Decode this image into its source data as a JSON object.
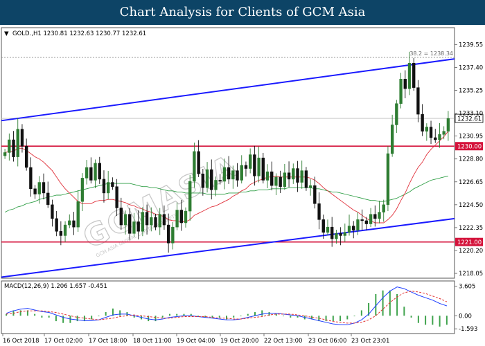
{
  "banner": {
    "title": "Chart Analysis for Clients of GCM Asia",
    "bg_color": "#0d4466"
  },
  "chart_data": [
    {
      "type": "candlestick",
      "symbol": "GOLD.,H1",
      "ohlc_text": "1230.81 1232.63 1230.77 1232.61",
      "header_text": "GOLD.,H1  1230.81 1232.63 1230.77 1232.61",
      "ylim": [
        1217.6,
        1241.0
      ],
      "y_ticks": [
        1239.55,
        1237.4,
        1235.25,
        1233.1,
        1230.95,
        1228.8,
        1226.65,
        1224.5,
        1222.35,
        1220.2,
        1218.05
      ],
      "x_ticks": [
        "16 Oct 2018",
        "17 Oct 02:00",
        "17 Oct 18:00",
        "18 Oct 11:00",
        "19 Oct 04:00",
        "19 Oct 20:00",
        "22 Oct 13:00",
        "23 Oct 06:00",
        "23 Oct 23:01"
      ],
      "current_price": "1232.61",
      "fib_label": "38.2 = 1238.34",
      "fib_level": 1238.34,
      "support_levels": [
        1230.0,
        1221.0
      ],
      "support_labels": [
        "1230.00",
        "1221.00"
      ],
      "trend_channel": {
        "upper": [
          1232.4,
          1238.2
        ],
        "lower": [
          1217.7,
          1223.2
        ]
      },
      "watermark": "GCMASIA",
      "watermark_sub": "GCM ASIA GLOBAL CAPITAL MARKETS",
      "closes": [
        1229.4,
        1230.6,
        1229.0,
        1231.6,
        1230.0,
        1228.0,
        1226.0,
        1225.5,
        1226.6,
        1225.6,
        1224.5,
        1223.2,
        1222.0,
        1221.6,
        1222.6,
        1223.0,
        1222.4,
        1224.8,
        1227.0,
        1228.0,
        1226.8,
        1228.4,
        1226.9,
        1225.6,
        1226.6,
        1226.2,
        1224.2,
        1222.6,
        1223.6,
        1221.8,
        1222.9,
        1222.0,
        1223.8,
        1222.6,
        1223.3,
        1222.4,
        1223.6,
        1222.6,
        1220.9,
        1222.4,
        1224.0,
        1222.8,
        1223.9,
        1226.7,
        1229.5,
        1227.4,
        1226.1,
        1227.8,
        1225.9,
        1226.8,
        1226.7,
        1228.0,
        1226.9,
        1227.7,
        1226.8,
        1228.2,
        1227.9,
        1229.2,
        1227.2,
        1228.9,
        1226.8,
        1227.6,
        1226.3,
        1227.1,
        1226.2,
        1227.5,
        1226.9,
        1227.9,
        1226.6,
        1227.7,
        1226.1,
        1226.3,
        1224.6,
        1223.1,
        1221.9,
        1222.4,
        1221.3,
        1221.8,
        1221.6,
        1221.9,
        1222.5,
        1222.1,
        1223.1,
        1223.0,
        1222.7,
        1223.6,
        1223.2,
        1223.8,
        1224.5,
        1229.3,
        1232.0,
        1234.0,
        1236.3,
        1235.4,
        1237.8,
        1235.5,
        1233.0,
        1231.4,
        1231.8,
        1230.8,
        1230.6,
        1231.1,
        1231.4,
        1232.6
      ],
      "ma_red": {
        "x_index": [
          0,
          1,
          2,
          3,
          4,
          5,
          6,
          7,
          8,
          9,
          10,
          11,
          12,
          13,
          14,
          15,
          16,
          17,
          18,
          19,
          20,
          21,
          22,
          23,
          24,
          25,
          26,
          27,
          28,
          29,
          30,
          31,
          32,
          33,
          34,
          35,
          36,
          37,
          38,
          39,
          40,
          41,
          42,
          43,
          44,
          45,
          46,
          47,
          48,
          49,
          50,
          51,
          52,
          53,
          54,
          55,
          56,
          57,
          58,
          59,
          60,
          61,
          62,
          63,
          64,
          65,
          66,
          67,
          68,
          69,
          70,
          71,
          72,
          73,
          74,
          75,
          76,
          77,
          78,
          79,
          80,
          81,
          82,
          83,
          84,
          85,
          86,
          87,
          88,
          89,
          90,
          91,
          92,
          93,
          94,
          95,
          96,
          97,
          98,
          99,
          100,
          101,
          102,
          103
        ],
        "values": [
          1229.4,
          1229.5,
          1229.5,
          1229.8,
          1229.8,
          1229.6,
          1229.3,
          1229.0,
          1228.8,
          1228.5,
          1228.1,
          1227.7,
          1227.1,
          1226.5,
          1226.0,
          1225.6,
          1225.2,
          1224.8,
          1224.6,
          1224.6,
          1224.6,
          1224.8,
          1224.9,
          1224.9,
          1225.0,
          1225.0,
          1224.9,
          1224.8,
          1224.7,
          1224.5,
          1224.4,
          1224.2,
          1224.1,
          1223.9,
          1223.8,
          1223.6,
          1223.5,
          1223.4,
          1223.1,
          1223.0,
          1223.0,
          1222.9,
          1222.9,
          1223.1,
          1223.5,
          1223.7,
          1223.9,
          1224.1,
          1224.3,
          1224.4,
          1224.6,
          1224.8,
          1225.0,
          1225.3,
          1225.5,
          1225.8,
          1226.0,
          1226.4,
          1226.6,
          1226.8,
          1226.9,
          1227.1,
          1227.1,
          1227.2,
          1227.1,
          1227.1,
          1227.1,
          1227.1,
          1227.1,
          1227.1,
          1227.1,
          1227.0,
          1226.8,
          1226.5,
          1226.1,
          1225.8,
          1225.5,
          1225.2,
          1224.9,
          1224.6,
          1224.3,
          1224.0,
          1223.8,
          1223.5,
          1223.2,
          1223.0,
          1222.8,
          1222.8,
          1222.8,
          1223.1,
          1223.5,
          1224.1,
          1224.9,
          1225.6,
          1226.5,
          1227.3,
          1228.0,
          1228.5,
          1229.2,
          1229.7,
          1230.1,
          1230.5,
          1230.9,
          1231.4
        ]
      },
      "ma_green": {
        "x_index": [
          0,
          1,
          2,
          3,
          4,
          5,
          6,
          7,
          8,
          9,
          10,
          11,
          12,
          13,
          14,
          15,
          16,
          17,
          18,
          19,
          20,
          21,
          22,
          23,
          24,
          25,
          26,
          27,
          28,
          29,
          30,
          31,
          32,
          33,
          34,
          35,
          36,
          37,
          38,
          39,
          40,
          41,
          42,
          43,
          44,
          45,
          46,
          47,
          48,
          49,
          50,
          51,
          52,
          53,
          54,
          55,
          56,
          57,
          58,
          59,
          60,
          61,
          62,
          63,
          64,
          65,
          66,
          67,
          68,
          69,
          70,
          71,
          72,
          73,
          74,
          75,
          76,
          77,
          78,
          79,
          80,
          81,
          82,
          83,
          84,
          85,
          86,
          87,
          88,
          89,
          90,
          91,
          92,
          93,
          94,
          95,
          96,
          97,
          98,
          99,
          100,
          101,
          102,
          103
        ],
        "values": [
          1223.8,
          1224.0,
          1224.1,
          1224.3,
          1224.4,
          1224.6,
          1224.7,
          1224.8,
          1225.0,
          1225.1,
          1225.2,
          1225.3,
          1225.4,
          1225.4,
          1225.5,
          1225.6,
          1225.7,
          1225.8,
          1225.9,
          1226.0,
          1226.1,
          1226.2,
          1226.3,
          1226.4,
          1226.5,
          1226.5,
          1226.5,
          1226.5,
          1226.5,
          1226.5,
          1226.4,
          1226.3,
          1226.2,
          1226.2,
          1226.1,
          1226.1,
          1226.0,
          1225.9,
          1225.8,
          1225.8,
          1225.7,
          1225.7,
          1225.6,
          1225.6,
          1225.6,
          1225.6,
          1225.6,
          1225.5,
          1225.5,
          1225.5,
          1225.5,
          1225.5,
          1225.6,
          1225.6,
          1225.6,
          1225.7,
          1225.7,
          1225.8,
          1225.8,
          1225.9,
          1225.9,
          1225.9,
          1226.0,
          1226.0,
          1226.0,
          1226.0,
          1226.1,
          1226.1,
          1226.1,
          1226.1,
          1226.1,
          1226.1,
          1226.0,
          1226.0,
          1225.9,
          1225.8,
          1225.7,
          1225.7,
          1225.6,
          1225.5,
          1225.4,
          1225.3,
          1225.2,
          1225.1,
          1225.0,
          1224.9,
          1224.9,
          1224.8,
          1224.8,
          1224.9,
          1225.0,
          1225.1,
          1225.3,
          1225.5,
          1225.7,
          1226.0,
          1226.2,
          1226.4,
          1226.6,
          1226.8,
          1226.9,
          1227.0,
          1227.1,
          1227.2
        ]
      }
    },
    {
      "type": "macd",
      "label": "MACD(12,26,9)",
      "values_text": "1.206 1.657 -0.451",
      "header_text": "MACD(12,26,9)  1.206 1.657 -0.451",
      "ylim": [
        -2.0,
        3.9
      ],
      "y_ticks": [
        3.605,
        0.0,
        -1.593
      ],
      "y_tick_labels": [
        "3.605",
        "0.00",
        "-1.593"
      ],
      "macd_line_blue": [
        0.3,
        0.6,
        0.8,
        0.9,
        0.7,
        0.5,
        0.4,
        0.1,
        -0.2,
        -0.4,
        -0.5,
        -0.6,
        -0.6,
        -0.5,
        -0.2,
        0.1,
        0.2,
        0.2,
        0.0,
        -0.2,
        -0.4,
        -0.5,
        -0.4,
        -0.2,
        -0.1,
        0.0,
        0.0,
        -0.1,
        -0.2,
        -0.3,
        -0.4,
        -0.5,
        -0.5,
        -0.4,
        -0.2,
        0.0,
        0.2,
        0.3,
        0.3,
        0.2,
        0.1,
        0.0,
        -0.2,
        -0.4,
        -0.6,
        -0.8,
        -1.0,
        -1.1,
        -1.1,
        -0.9,
        -0.5,
        0.2,
        1.2,
        2.2,
        3.0,
        3.5,
        3.3,
        2.9,
        2.5,
        2.2,
        1.9,
        1.5,
        1.2
      ],
      "signal_line_red": [
        0.2,
        0.3,
        0.5,
        0.6,
        0.6,
        0.6,
        0.5,
        0.4,
        0.2,
        0.0,
        -0.2,
        -0.3,
        -0.4,
        -0.5,
        -0.4,
        -0.3,
        -0.1,
        0.0,
        0.1,
        0.0,
        -0.1,
        -0.2,
        -0.3,
        -0.3,
        -0.2,
        -0.1,
        -0.1,
        -0.1,
        -0.1,
        -0.2,
        -0.3,
        -0.3,
        -0.4,
        -0.4,
        -0.3,
        -0.2,
        -0.1,
        0.1,
        0.2,
        0.2,
        0.2,
        0.1,
        0.0,
        -0.2,
        -0.3,
        -0.5,
        -0.7,
        -0.8,
        -0.9,
        -0.9,
        -0.8,
        -0.5,
        0.0,
        0.8,
        1.6,
        2.3,
        2.8,
        3.0,
        2.9,
        2.7,
        2.4,
        2.1,
        1.7
      ]
    }
  ],
  "colors": {
    "up_candle": "#2e7d32",
    "down_candle": "#111111",
    "ma_red": "#e0303a",
    "ma_green": "#2e9e45",
    "channel": "#1a1aff",
    "support": "#d4123a",
    "fib": "#888888",
    "macd_blue": "#1f3fff",
    "macd_red": "#e23030",
    "macd_hist": "#3fa34d"
  }
}
